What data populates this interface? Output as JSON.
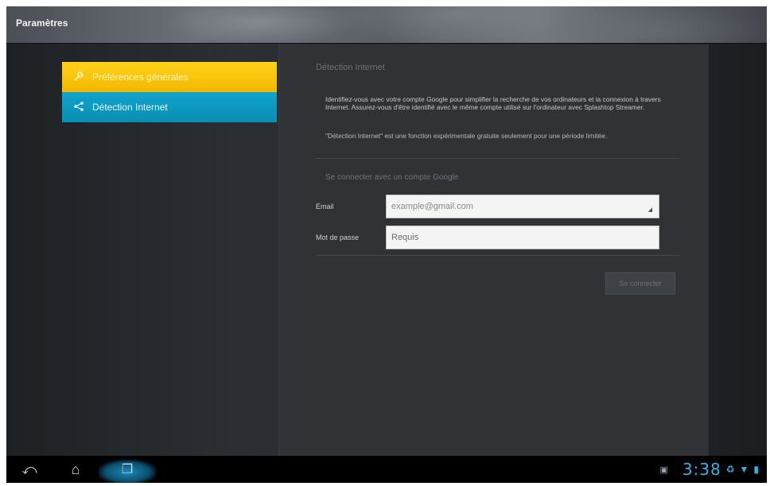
{
  "window": {
    "title": "Paramètres"
  },
  "menu": {
    "items": [
      {
        "label": "Préférences générales",
        "icon": "wrench-icon",
        "selected": true,
        "color": "#f6c000"
      },
      {
        "label": "Détection Internet",
        "icon": "share-icon",
        "selected": false,
        "color": "#0e9cc3"
      }
    ]
  },
  "panel": {
    "header": "Détection Internet",
    "description": "Identifiez-vous avec votre compte Google pour simplifier la recherche de vos ordinateurs et la connexion à travers Internet. Assurez-vous d'être identifié avec le même compte utilisé sur l'ordinateur avec Splashtop Streamer.",
    "note": "\"Détection Internet\" est une fonction expérimentale gratuite seulement pour une période limitée.",
    "section_title": "Se connecter avec un compte Google",
    "email": {
      "label": "Email",
      "value": "example@gmail.com"
    },
    "password": {
      "label": "Mot de passe",
      "placeholder": "Requis"
    },
    "login_button": "Se connecter"
  },
  "navbar": {
    "back_icon": "back-icon",
    "home_icon": "home-icon",
    "recent_icon": "recent-apps-icon"
  },
  "status": {
    "time": "3:38",
    "accent": "#2fb6e6"
  }
}
